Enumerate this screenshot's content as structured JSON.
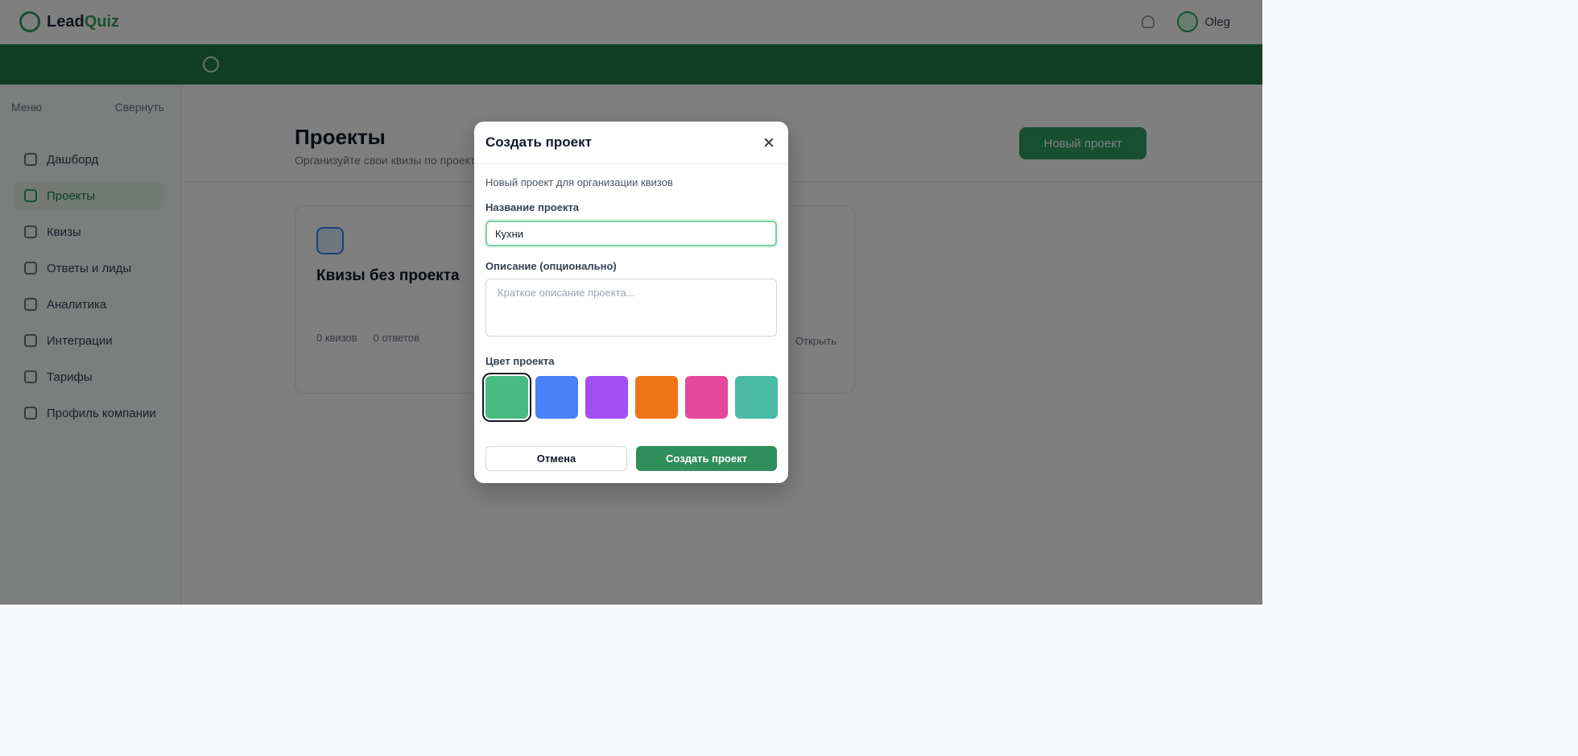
{
  "background": {
    "logo": {
      "text": "Lead",
      "accent": "Quiz"
    },
    "user_name": "Oleg",
    "sidebar": {
      "head_left": "Меню",
      "head_right": "Свернуть",
      "items": [
        {
          "label": "Дашборд"
        },
        {
          "label": "Проекты"
        },
        {
          "label": "Квизы"
        },
        {
          "label": "Ответы и лиды"
        },
        {
          "label": "Аналитика"
        },
        {
          "label": "Интеграции"
        },
        {
          "label": "Тарифы"
        },
        {
          "label": "Профиль компании"
        }
      ]
    },
    "page": {
      "title": "Проекты",
      "subtitle": "Организуйте свои квизы по проектам",
      "create_button": "Новый проект"
    },
    "card": {
      "title": "Квизы без проекта",
      "meta_1": "0 квизов",
      "meta_2": "0 ответов",
      "right": "Открыть"
    }
  },
  "modal": {
    "title": "Создать проект",
    "description": "Новый проект для организации квизов",
    "name_label": "Название проекта",
    "name_value": "Кухни",
    "desc_label": "Описание (опционально)",
    "desc_placeholder": "Краткое описание проекта...",
    "color_label": "Цвет проекта",
    "colors": [
      "#48bb80",
      "#4a81f8",
      "#a24ef2",
      "#f07416",
      "#e3489a",
      "#49baa7"
    ],
    "selected_color_index": 0,
    "cancel_label": "Отмена",
    "submit_label": "Создать проект"
  }
}
